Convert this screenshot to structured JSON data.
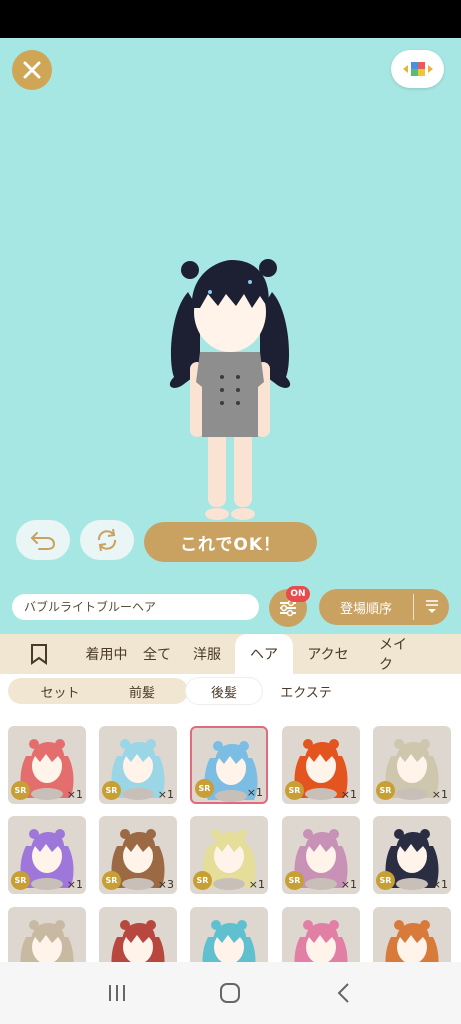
{
  "toolbar": {
    "close_icon": "close-icon",
    "palette_icon": "palette-icon",
    "undo_icon": "undo-icon",
    "refresh_icon": "refresh-icon",
    "confirm_label": "これでOK！"
  },
  "item_bar": {
    "item_name": "バブルライトブルーヘア",
    "filter_badge": "ON",
    "sort_label": "登場順序"
  },
  "tabs": [
    {
      "label": "",
      "icon": "bookmark-icon"
    },
    {
      "label": "着用中"
    },
    {
      "label": "全て"
    },
    {
      "label": "洋服"
    },
    {
      "label": "ヘア",
      "active": true
    },
    {
      "label": "アクセ"
    },
    {
      "label": "メイク"
    }
  ],
  "subtabs": [
    {
      "label": "セット"
    },
    {
      "label": "前髪"
    },
    {
      "label": "後髪",
      "active": true
    },
    {
      "label": "エクステ"
    }
  ],
  "items": [
    {
      "rarity": "SR",
      "qty": "×1",
      "hair": "#e46e6e"
    },
    {
      "rarity": "SR",
      "qty": "×1",
      "hair": "#9ad6e6"
    },
    {
      "rarity": "SR",
      "qty": "×1",
      "hair": "#7bbde3",
      "selected": true
    },
    {
      "rarity": "SR",
      "qty": "×1",
      "hair": "#e4541f"
    },
    {
      "rarity": "SR",
      "qty": "×1",
      "hair": "#cfc7ad"
    },
    {
      "rarity": "SR",
      "qty": "×1",
      "hair": "#9f76d9"
    },
    {
      "rarity": "SR",
      "qty": "×3",
      "hair": "#9b6a44"
    },
    {
      "rarity": "SR",
      "qty": "×1",
      "hair": "#e4de9a"
    },
    {
      "rarity": "SR",
      "qty": "×1",
      "hair": "#c792b5"
    },
    {
      "rarity": "SR",
      "qty": "×1",
      "hair": "#2b2e43"
    },
    {
      "rarity": "",
      "qty": "",
      "hair": "#c8b9a2"
    },
    {
      "rarity": "",
      "qty": "",
      "hair": "#b8483f"
    },
    {
      "rarity": "",
      "qty": "",
      "hair": "#5fc1d0"
    },
    {
      "rarity": "",
      "qty": "",
      "hair": "#e17fa4"
    },
    {
      "rarity": "",
      "qty": "",
      "hair": "#d77a3a"
    }
  ],
  "colors": {
    "background": "#a6e7e4",
    "accent": "#c9a262",
    "badge": "#e94b4b",
    "selected_border": "#e06b7d"
  },
  "system_nav": {
    "recent_icon": "recent-apps-icon",
    "home_icon": "home-icon",
    "back_icon": "back-icon"
  }
}
